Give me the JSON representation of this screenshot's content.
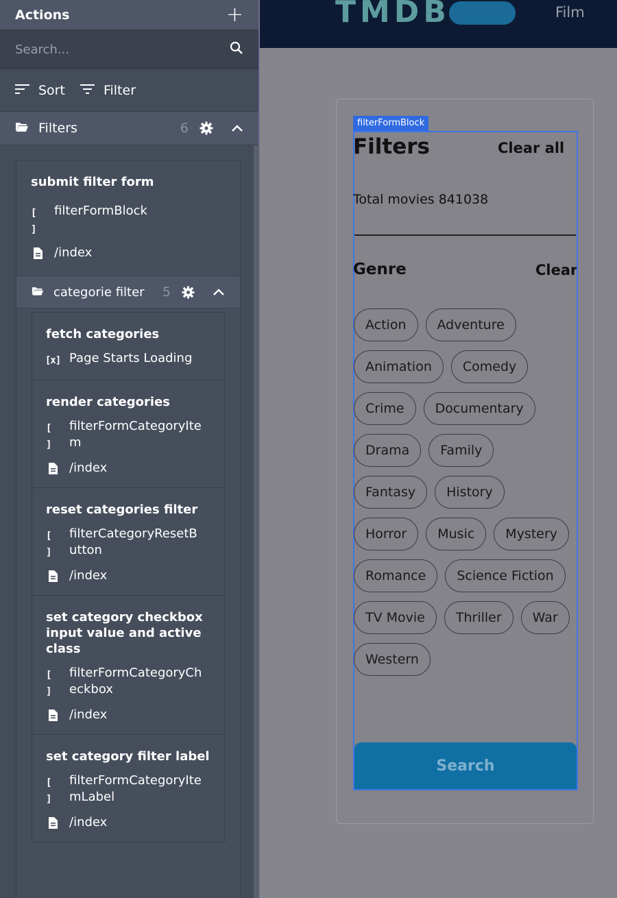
{
  "panel": {
    "title": "Actions",
    "search_placeholder": "Search...",
    "sort_label": "Sort",
    "filter_label": "Filter",
    "section": {
      "label": "Filters",
      "count": "6"
    }
  },
  "submit_block": {
    "title": "submit filter form",
    "element": "filterFormBlock",
    "page": "/index"
  },
  "category_group": {
    "label": "categorie filter",
    "count": "5"
  },
  "items": [
    {
      "title": "fetch categories",
      "trigger": "Page Starts Loading"
    },
    {
      "title": "render categories",
      "element": "filterFormCategoryIte\nm",
      "page": "/index"
    },
    {
      "title": "reset categories filter",
      "element": "filterCategoryResetB\nutton",
      "page": "/index"
    },
    {
      "title": "set category checkbox\ninput value and active\nclass",
      "element": "filterFormCategoryCh\neckbox",
      "page": "/index"
    },
    {
      "title": "set category filter label",
      "element": "filterFormCategoryIte\nmLabel",
      "page": "/index"
    }
  ],
  "site": {
    "logo": "TMDB",
    "nav_film": "Film",
    "block_tag": "filterFormBlock",
    "filters_title": "Filters",
    "clear_all": "Clear all",
    "total": "Total movies 841038",
    "genre_title": "Genre",
    "genre_clear": "Clear",
    "genres": [
      "Action",
      "Adventure",
      "Animation",
      "Comedy",
      "Crime",
      "Documentary",
      "Drama",
      "Family",
      "Fantasy",
      "History",
      "Horror",
      "Music",
      "Mystery",
      "Romance",
      "Science Fiction",
      "TV Movie",
      "Thriller",
      "War",
      "Western"
    ],
    "search_button": "Search"
  },
  "icons": {
    "add": "plus-icon",
    "search": "magnifier-icon",
    "sort": "sort-lines-icon",
    "filter": "filter-lines-icon",
    "folder": "folder-open-icon",
    "gear": "gear-icon",
    "collapse": "chevron-up-icon",
    "element": "brackets-icon",
    "page": "document-icon",
    "trigger": "variable-icon"
  }
}
